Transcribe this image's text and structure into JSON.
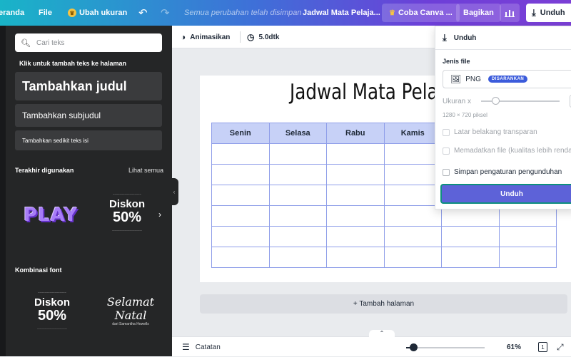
{
  "topbar": {
    "home_label": "eranda",
    "file_label": "File",
    "resize_label": "Ubah ukuran",
    "undo_icon": "↶",
    "redo_icon": "↷",
    "save_status": "Semua perubahan telah disimpan",
    "doc_title": "Jadwal Mata Pelaja...",
    "try_canva_label": "Coba Canva ...",
    "share_label": "Bagikan",
    "download_label": "Unduh"
  },
  "panel": {
    "search_placeholder": "Cari teks",
    "hint": "Klik untuk tambah teks ke halaman",
    "add_heading": "Tambahkan judul",
    "add_subheading": "Tambahkan subjudul",
    "add_body": "Tambahkan sedikit teks isi",
    "recent_title": "Terakhir digunakan",
    "see_all": "Lihat semua",
    "recent_items": {
      "play_text": "PLAY",
      "diskon_text": "Diskon",
      "percent_text": "50%"
    },
    "combo_title": "Kombinasi font",
    "combo_items": {
      "diskon_text": "Diskon",
      "percent_text": "50%",
      "natal_line1": "Selamat",
      "natal_line2": "Natal",
      "natal_byline": "dari Samantha Howells"
    }
  },
  "editor_toolbar": {
    "animate_label": "Animasikan",
    "duration_label": "5.0dtk"
  },
  "canvas": {
    "title": "Jadwal Mata Pelajaran",
    "table_headers": [
      "Senin",
      "Selasa",
      "Rabu",
      "Kamis",
      "",
      ""
    ],
    "empty_rows": 6,
    "add_page_label": "+ Tambah halaman"
  },
  "bottombar": {
    "notes_label": "Catatan",
    "zoom": "61%",
    "page_count": "1",
    "zoom_fraction": 0.09
  },
  "download_panel": {
    "header": "Unduh",
    "file_type_label": "Jenis file",
    "file_type_value": "PNG",
    "recommended_badge": "DISARANKAN",
    "size_label": "Ukuran x",
    "dimensions": "1280 × 720 piksel",
    "transparent_bg": "Latar belakang transparan",
    "compress_file": "Memadatkan file (kualitas lebih renda",
    "save_settings": "Simpan pengaturan pengunduhan",
    "download_button": "Unduh"
  },
  "colors": {
    "topbar_start": "#19b4c8",
    "topbar_end": "#7b3fd6",
    "panel_bg": "#252627",
    "table_header_bg": "#c7d1f7",
    "primary_button": "#5d62d8",
    "badge": "#3b5bdb"
  }
}
